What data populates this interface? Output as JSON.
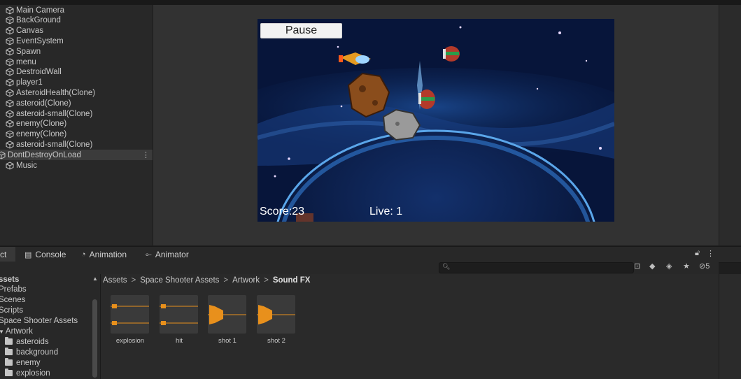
{
  "hierarchy": {
    "items": [
      {
        "label": "Main Camera"
      },
      {
        "label": "BackGround"
      },
      {
        "label": "Canvas"
      },
      {
        "label": "EventSystem"
      },
      {
        "label": "Spawn"
      },
      {
        "label": "menu"
      },
      {
        "label": "DestroidWall"
      },
      {
        "label": "player1"
      },
      {
        "label": "AsteroidHealth(Clone)"
      },
      {
        "label": "asteroid(Clone)"
      },
      {
        "label": "asteroid-small(Clone)"
      },
      {
        "label": "enemy(Clone)"
      },
      {
        "label": "enemy(Clone)"
      },
      {
        "label": "asteroid-small(Clone)"
      }
    ],
    "root_item": {
      "label": "DontDestroyOnLoad",
      "menu": "⋮"
    },
    "child_item": {
      "label": "Music"
    }
  },
  "game": {
    "pause_label": "Pause",
    "score_text": "Score:23",
    "lives_text": "Live: 1"
  },
  "bottom_tabs": {
    "project": "ct",
    "console": "Console",
    "animation": "Animation",
    "animator": "Animator"
  },
  "toolbar": {
    "hidden_count": "5"
  },
  "project_tree": {
    "items": [
      {
        "label": "ssets",
        "indent": 0,
        "bold": true
      },
      {
        "label": "Prefabs",
        "indent": 0
      },
      {
        "label": "Scenes",
        "indent": 0
      },
      {
        "label": "Scripts",
        "indent": 0
      },
      {
        "label": "Space Shooter Assets",
        "indent": 0
      },
      {
        "label": "Artwork",
        "indent": 0,
        "expanded": true
      },
      {
        "label": "asteroids",
        "indent": 1,
        "folder": true
      },
      {
        "label": "background",
        "indent": 1,
        "folder": true
      },
      {
        "label": "enemy",
        "indent": 1,
        "folder": true
      },
      {
        "label": "explosion",
        "indent": 1,
        "folder": true
      }
    ]
  },
  "breadcrumb": {
    "parts": [
      "Assets",
      "Space Shooter Assets",
      "Artwork"
    ],
    "current": "Sound FX",
    "separator": ">"
  },
  "assets": [
    {
      "label": "explosion",
      "kind": "audio-waveform"
    },
    {
      "label": "hit",
      "kind": "audio-waveform"
    },
    {
      "label": "shot 1",
      "kind": "audio-burst"
    },
    {
      "label": "shot 2",
      "kind": "audio-burst"
    }
  ],
  "colors": {
    "accent_audio": "#e8901c",
    "hud_text": "#ffffff"
  }
}
